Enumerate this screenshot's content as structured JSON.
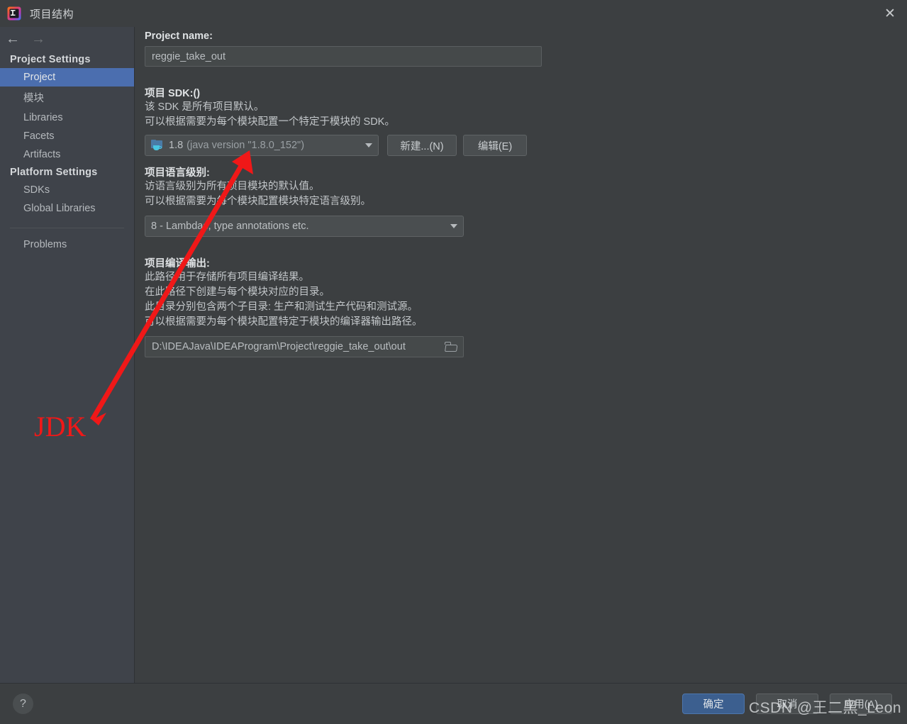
{
  "window": {
    "title": "项目结构",
    "app_icon": "intellij-idea-icon",
    "close_label": "✕"
  },
  "nav": {
    "back_icon": "arrow-left-icon",
    "back_glyph": "←",
    "forward_icon": "arrow-right-icon",
    "forward_glyph": "→"
  },
  "sidebar": {
    "groups": [
      {
        "label": "Project Settings",
        "items": [
          {
            "label": "Project",
            "selected": true
          },
          {
            "label": "模块",
            "selected": false
          },
          {
            "label": "Libraries",
            "selected": false
          },
          {
            "label": "Facets",
            "selected": false
          },
          {
            "label": "Artifacts",
            "selected": false
          }
        ]
      },
      {
        "label": "Platform Settings",
        "items": [
          {
            "label": "SDKs",
            "selected": false
          },
          {
            "label": "Global Libraries",
            "selected": false
          }
        ]
      }
    ],
    "extra_item": "Problems"
  },
  "main": {
    "project_name": {
      "label": "Project name:",
      "value": "reggie_take_out"
    },
    "sdk": {
      "label": "项目 SDK:()",
      "desc_line1": "该 SDK 是所有项目默认。",
      "desc_line2": "可以根据需要为每个模块配置一个特定于模块的 SDK。",
      "selected_name": "1.8",
      "selected_detail": "(java version \"1.8.0_152\")",
      "icon": "java-sdk-folder-icon",
      "new_button": "新建...(N)",
      "edit_button": "编辑(E)"
    },
    "language_level": {
      "label": "项目语言级别:",
      "desc_line1": "访语言级别为所有项目模块的默认值。",
      "desc_line2": "可以根据需要为每个模块配置模块特定语言级别。",
      "value": "8 - Lambdas, type annotations etc."
    },
    "compiler_output": {
      "label": "项目编译输出:",
      "desc_line1": "此路径用于存储所有项目编译结果。",
      "desc_line2": "在此路径下创建与每个模块对应的目录。",
      "desc_line3": "此目录分别包含两个子目录: 生产和测试生产代码和测试源。",
      "desc_line4": "可以根据需要为每个模块配置特定于模块的编译器输出路径。",
      "value": "D:\\IDEAJava\\IDEAProgram\\Project\\reggie_take_out\\out",
      "browse_icon": "folder-browse-icon"
    }
  },
  "annotation": {
    "label": "JDK",
    "color": "#f01818",
    "arrow_icon": "red-arrow-annotation"
  },
  "footer": {
    "help_label": "?",
    "ok_button": "确定",
    "cancel_button": "取消",
    "apply_button": "应用(A)",
    "watermark": "CSDN @王二黑_Leon"
  }
}
